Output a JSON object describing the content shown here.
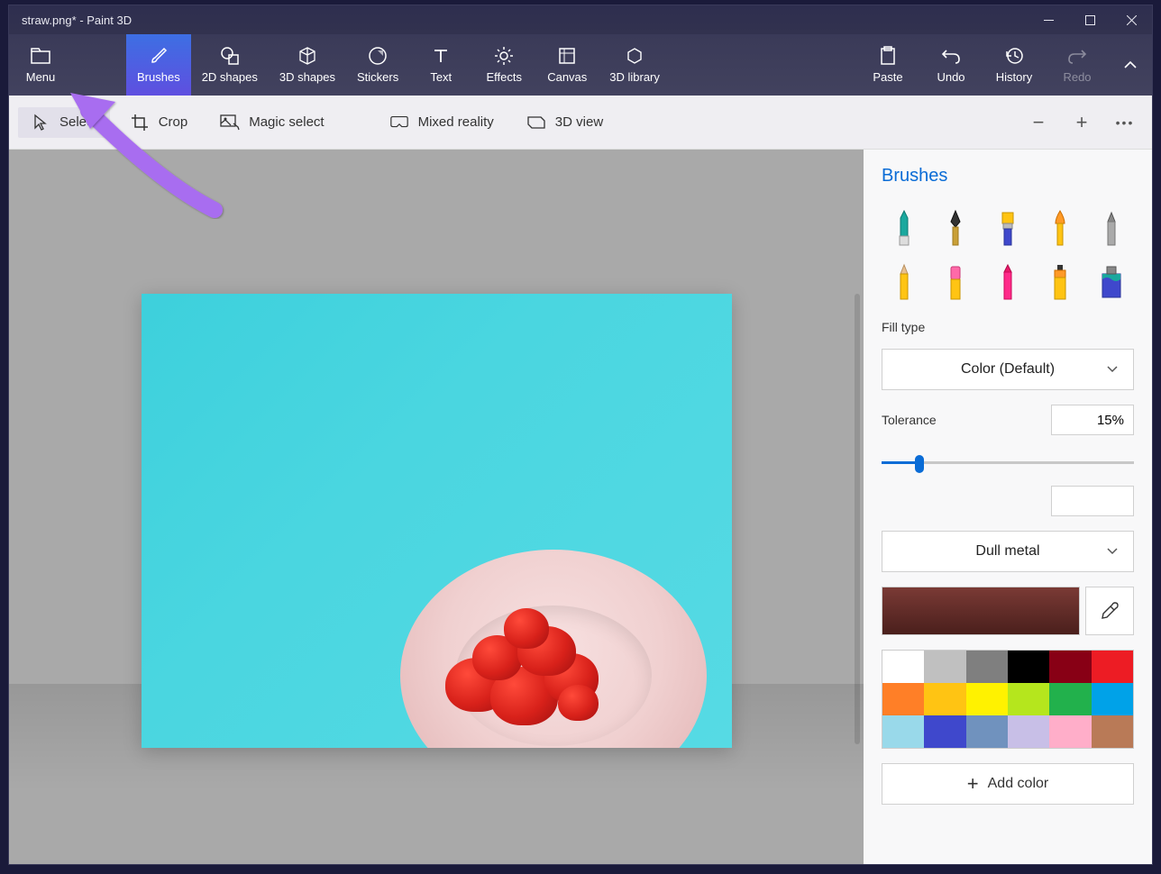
{
  "title": "straw.png* - Paint 3D",
  "ribbon": {
    "menu": "Menu",
    "brushes": "Brushes",
    "shapes2d": "2D shapes",
    "shapes3d": "3D shapes",
    "stickers": "Stickers",
    "text": "Text",
    "effects": "Effects",
    "canvas": "Canvas",
    "library3d": "3D library",
    "paste": "Paste",
    "undo": "Undo",
    "history": "History",
    "redo": "Redo"
  },
  "toolbar": {
    "select": "Select",
    "crop": "Crop",
    "magic_select": "Magic select",
    "mixed_reality": "Mixed reality",
    "view3d": "3D view"
  },
  "side": {
    "title": "Brushes",
    "fill_type_label": "Fill type",
    "fill_type_value": "Color (Default)",
    "tolerance_label": "Tolerance",
    "tolerance_value": "15%",
    "material_value": "Dull metal",
    "add_color": "Add color",
    "palette": [
      "#ffffff",
      "#c0c0c0",
      "#7f7f7f",
      "#000000",
      "#880015",
      "#ed1c24",
      "#ff7f27",
      "#ffc413",
      "#fff200",
      "#b5e61d",
      "#22b14c",
      "#00a2e8",
      "#99d9ea",
      "#3f48cc",
      "#7092be",
      "#c8bfe7",
      "#ffaec9",
      "#b97a57"
    ]
  }
}
